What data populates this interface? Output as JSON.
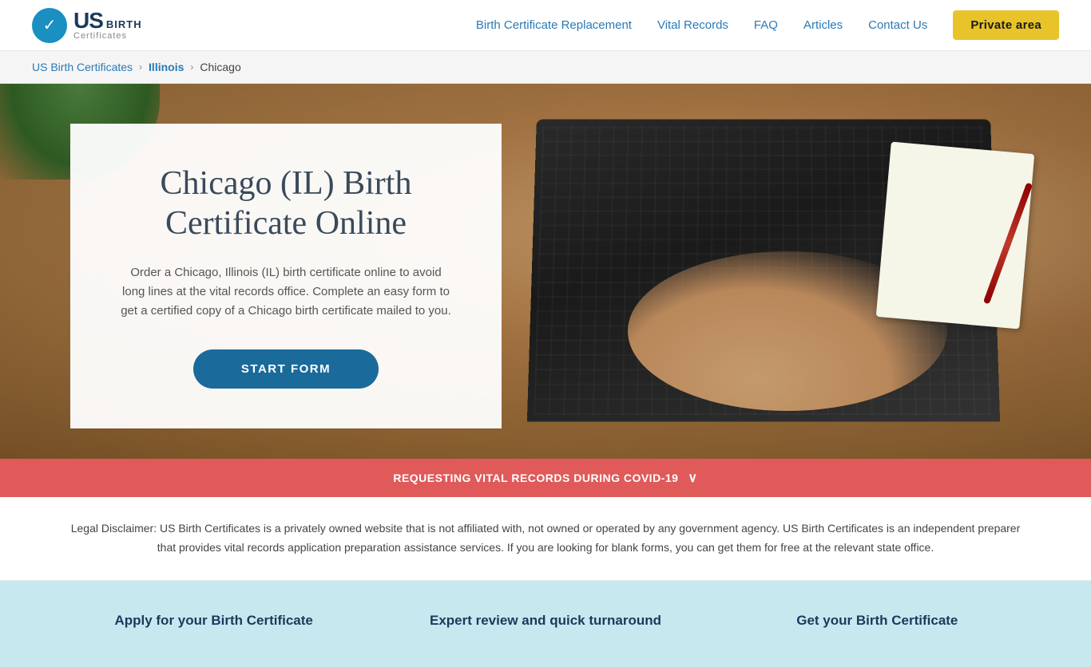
{
  "header": {
    "logo": {
      "us_text": "US",
      "birth_text": "BIRTH",
      "certificates_text": "Certificates",
      "checkmark": "✓"
    },
    "nav": {
      "birth_cert": "Birth Certificate Replacement",
      "vital_records": "Vital Records",
      "faq": "FAQ",
      "articles": "Articles",
      "contact": "Contact Us",
      "private_area": "Private area"
    }
  },
  "breadcrumb": {
    "home": "US Birth Certificates",
    "sep1": "›",
    "state": "Illinois",
    "sep2": "›",
    "city": "Chicago"
  },
  "hero": {
    "title": "Chicago (IL) Birth Certificate Online",
    "description": "Order a Chicago, Illinois (IL) birth certificate online to avoid long lines at the vital records office. Complete an easy form to get a certified copy of a Chicago birth certificate mailed to you.",
    "start_btn": "START FORM"
  },
  "covid_banner": {
    "text": "REQUESTING VITAL RECORDS DURING COVID-19",
    "chevron": "∨"
  },
  "disclaimer": {
    "text": "Legal Disclaimer: US Birth Certificates is a privately owned website that is not affiliated with, not owned or operated by any government agency. US Birth Certificates is an independent preparer that provides vital records application preparation assistance services. If you are looking for blank forms, you can get them for free at the relevant state office."
  },
  "features": {
    "items": [
      {
        "title": "Apply for your Birth Certificate"
      },
      {
        "title": "Expert review and quick turnaround"
      },
      {
        "title": "Get your Birth Certificate"
      }
    ]
  }
}
